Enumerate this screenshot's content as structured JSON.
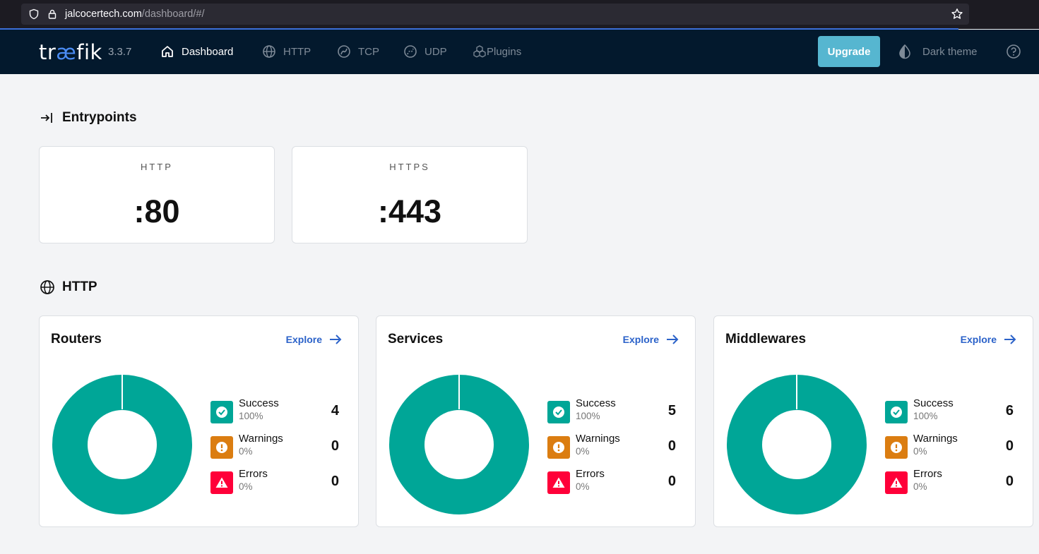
{
  "browser": {
    "url_host": "jalcocertech.com",
    "url_path": "/dashboard/#/"
  },
  "navbar": {
    "logo_pre": "tr",
    "logo_ae": "æ",
    "logo_post": "fik",
    "version": "3.3.7",
    "items": [
      {
        "label": "Dashboard",
        "icon": "home-icon",
        "active": true
      },
      {
        "label": "HTTP",
        "icon": "globe-icon",
        "active": false
      },
      {
        "label": "TCP",
        "icon": "tcp-icon",
        "active": false
      },
      {
        "label": "UDP",
        "icon": "udp-icon",
        "active": false
      },
      {
        "label": "Plugins",
        "icon": "plugins-icon",
        "active": false
      }
    ],
    "upgrade_label": "Upgrade",
    "theme_label": "Dark theme"
  },
  "entrypoints": {
    "title": "Entrypoints",
    "items": [
      {
        "name": "HTTP",
        "port": ":80"
      },
      {
        "name": "HTTPS",
        "port": ":443"
      }
    ]
  },
  "http": {
    "title": "HTTP",
    "explore_label": "Explore",
    "cards": [
      {
        "title": "Routers",
        "stats": [
          {
            "label": "Success",
            "pct": "100%",
            "count": "4"
          },
          {
            "label": "Warnings",
            "pct": "0%",
            "count": "0"
          },
          {
            "label": "Errors",
            "pct": "0%",
            "count": "0"
          }
        ]
      },
      {
        "title": "Services",
        "stats": [
          {
            "label": "Success",
            "pct": "100%",
            "count": "5"
          },
          {
            "label": "Warnings",
            "pct": "0%",
            "count": "0"
          },
          {
            "label": "Errors",
            "pct": "0%",
            "count": "0"
          }
        ]
      },
      {
        "title": "Middlewares",
        "stats": [
          {
            "label": "Success",
            "pct": "100%",
            "count": "6"
          },
          {
            "label": "Warnings",
            "pct": "0%",
            "count": "0"
          },
          {
            "label": "Errors",
            "pct": "0%",
            "count": "0"
          }
        ]
      }
    ]
  },
  "colors": {
    "success": "#00a697",
    "warning": "#db7d11",
    "error": "#ff0039",
    "navbar": "#03192d",
    "accent": "#56b6d0"
  }
}
